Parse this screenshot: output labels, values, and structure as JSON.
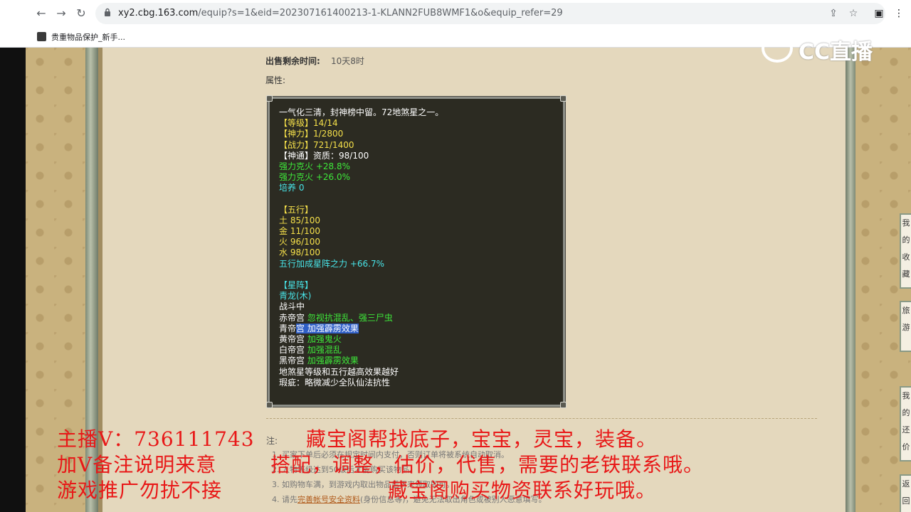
{
  "browser": {
    "url_host": "xy2.cbg.163.com",
    "url_path": "/equip?s=1&eid=202307161400213-1-KLANN2FUB8WMF1&o&equip_refer=29",
    "bookmark_label": "贵重物品保护_新手..."
  },
  "listing": {
    "time_label": "出售剩余时间:",
    "time_value": "10天8时",
    "attr_label": "属性:"
  },
  "attributes": [
    {
      "segments": [
        {
          "t": "一气化三清，封神榜中留。72地煞星之一。",
          "c": "white"
        }
      ]
    },
    {
      "segments": [
        {
          "t": " 【等级】14/14",
          "c": "yellow"
        }
      ]
    },
    {
      "segments": [
        {
          "t": " 【神力】1/2800",
          "c": "yellow"
        }
      ]
    },
    {
      "segments": [
        {
          "t": " 【战力】721/1400",
          "c": "yellow"
        }
      ]
    },
    {
      "segments": [
        {
          "t": " 【神通】资质：98/100",
          "c": "white"
        }
      ]
    },
    {
      "segments": [
        {
          "t": "强力克火 +28.8%",
          "c": "green"
        }
      ]
    },
    {
      "segments": [
        {
          "t": "强力克火 +26.0%",
          "c": "green"
        }
      ]
    },
    {
      "segments": [
        {
          "t": "培养 0",
          "c": "cyan"
        }
      ]
    },
    {
      "segments": [
        {
          "t": "",
          "c": "white"
        }
      ]
    },
    {
      "segments": [
        {
          "t": " 【五行】",
          "c": "yellow"
        }
      ]
    },
    {
      "segments": [
        {
          "t": "土 85/100",
          "c": "yellow"
        }
      ]
    },
    {
      "segments": [
        {
          "t": "金 11/100",
          "c": "yellow"
        }
      ]
    },
    {
      "segments": [
        {
          "t": "火 96/100",
          "c": "yellow"
        }
      ]
    },
    {
      "segments": [
        {
          "t": "水 98/100",
          "c": "yellow"
        }
      ]
    },
    {
      "segments": [
        {
          "t": "五行加成星阵之力 +66.7%",
          "c": "cyan"
        }
      ]
    },
    {
      "segments": [
        {
          "t": "",
          "c": "white"
        }
      ]
    },
    {
      "segments": [
        {
          "t": " 【星阵】",
          "c": "cyan"
        }
      ]
    },
    {
      "segments": [
        {
          "t": "青龙(木)",
          "c": "cyan"
        }
      ]
    },
    {
      "segments": [
        {
          "t": "战斗中",
          "c": "white"
        }
      ]
    },
    {
      "segments": [
        {
          "t": "赤帝宫 ",
          "c": "white"
        },
        {
          "t": "忽视抗混乱、强三尸虫",
          "c": "green"
        }
      ]
    },
    {
      "segments": [
        {
          "t": "青帝",
          "c": "white"
        },
        {
          "t": "宫 加强霹雳效果",
          "c": "hl"
        }
      ]
    },
    {
      "segments": [
        {
          "t": "黄帝宫 ",
          "c": "white"
        },
        {
          "t": "加强鬼火",
          "c": "green"
        }
      ]
    },
    {
      "segments": [
        {
          "t": "白帝宫 ",
          "c": "white"
        },
        {
          "t": "加强混乱",
          "c": "green"
        }
      ]
    },
    {
      "segments": [
        {
          "t": "黑帝宫 ",
          "c": "white"
        },
        {
          "t": "加强霹雳效果",
          "c": "green"
        }
      ]
    },
    {
      "segments": [
        {
          "t": "地煞星等级和五行越高效果越好",
          "c": "white"
        }
      ]
    },
    {
      "segments": [
        {
          "t": "瑕疵：略微减少全队仙法抗性",
          "c": "white"
        }
      ]
    }
  ],
  "notes": {
    "label": "注:",
    "lines": [
      "1. 买家下单后必须在规定时间内支付，否则订单将被系统自动取消。",
      "2. 人物等级达到50级后才能购买该物品。",
      "3. 如购物车满，到游戏内取出物品后再来领取即可。"
    ],
    "line4_prefix": "4. 请先",
    "line4_link": "完善帐号安全资料",
    "line4_suffix": "(身份信息等)，避免无法取出角色或被别人恶意填写。"
  },
  "overlay": {
    "left1": "主播V：736111743",
    "left2": "加V备注说明来意",
    "left3": "游戏推广勿扰不接",
    "right1": "藏宝阁帮找底子，宝宝，灵宝，装备。",
    "right2": "搭配，调整，估价，代售，需要的老铁联系哦。",
    "right3": "藏宝阁购买物资联系好玩哦。",
    "logo": "CC直播"
  },
  "side_tabs": [
    "我的收藏",
    "旅游",
    "我的还价",
    "返回"
  ]
}
